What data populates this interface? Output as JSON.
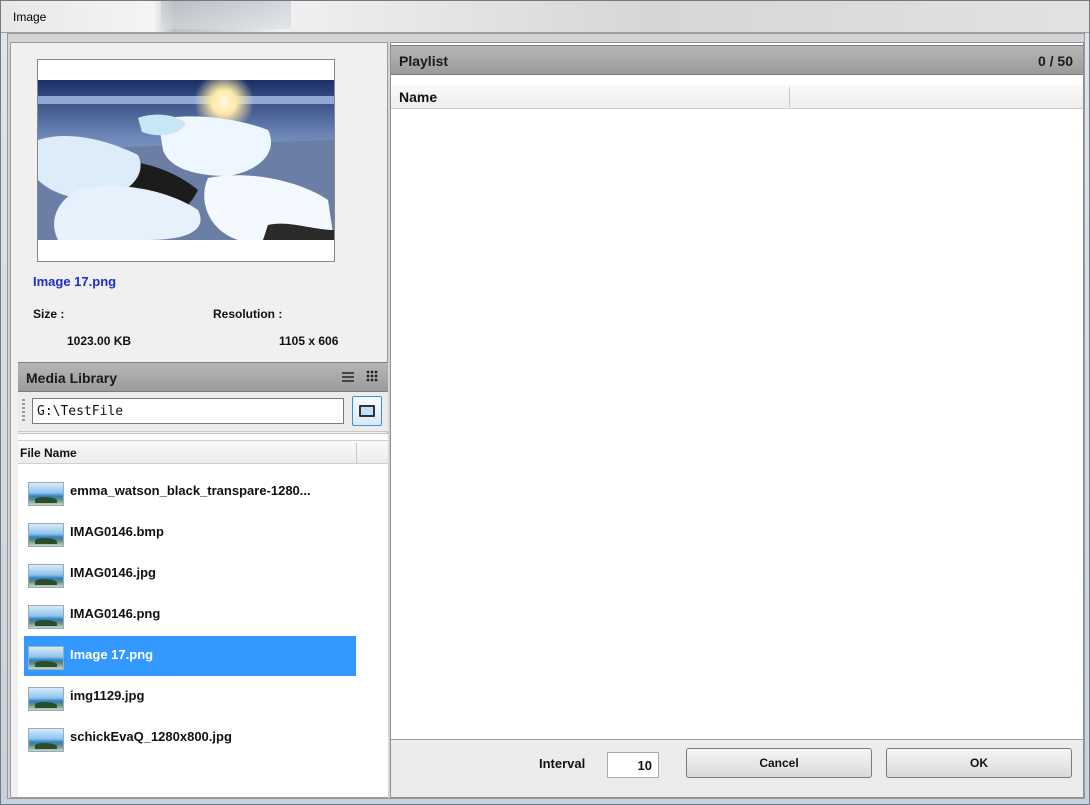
{
  "window": {
    "title": "Image"
  },
  "preview": {
    "file_name": "Image 17.png",
    "size_label": "Size :",
    "size_value": "1023.00 KB",
    "resolution_label": "Resolution :",
    "resolution_value": "1105 x 606"
  },
  "media_library": {
    "title": "Media Library",
    "path": "G:\\TestFile",
    "column_header": "File Name",
    "files": [
      {
        "name": "emma_watson_black_transpare-1280...",
        "selected": false
      },
      {
        "name": "IMAG0146.bmp",
        "selected": false
      },
      {
        "name": "IMAG0146.jpg",
        "selected": false
      },
      {
        "name": "IMAG0146.png",
        "selected": false
      },
      {
        "name": "Image 17.png",
        "selected": true
      },
      {
        "name": "img1129.jpg",
        "selected": false
      },
      {
        "name": "schickEvaQ_1280x800.jpg",
        "selected": false
      }
    ]
  },
  "playlist": {
    "title": "Playlist",
    "count": "0 / 50",
    "column_header": "Name"
  },
  "footer": {
    "interval_label": "Interval",
    "interval_value": "10",
    "cancel_label": "Cancel",
    "ok_label": "OK"
  },
  "colors": {
    "selection": "#3399ff",
    "file_title": "#1c2ccc",
    "panel_header": "#a9a9a9"
  },
  "icons": [
    "film-icon",
    "list-view-icon",
    "grid-view-icon",
    "image-thumbnail-icon"
  ]
}
